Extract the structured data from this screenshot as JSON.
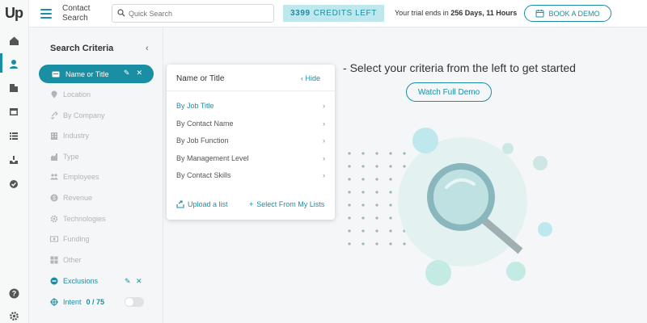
{
  "app": {
    "logo": "Up"
  },
  "header": {
    "page_title": "Contact Search",
    "search_placeholder": "Quick Search",
    "credits_number": "3399",
    "credits_label": "CREDITS LEFT",
    "trial_prefix": "Your trial ends in",
    "trial_value": "256 Days, 11 Hours",
    "book_demo": "BOOK A DEMO"
  },
  "criteria": {
    "title": "Search Criteria",
    "items": [
      {
        "label": "Name or Title",
        "icon": "id-card-icon"
      },
      {
        "label": "Location",
        "icon": "map-pin-icon"
      },
      {
        "label": "By Company",
        "icon": "link-icon"
      },
      {
        "label": "Industry",
        "icon": "building-icon"
      },
      {
        "label": "Type",
        "icon": "factory-icon"
      },
      {
        "label": "Employees",
        "icon": "people-icon"
      },
      {
        "label": "Revenue",
        "icon": "dollar-icon"
      },
      {
        "label": "Technologies",
        "icon": "gear-icon"
      },
      {
        "label": "Funding",
        "icon": "money-icon"
      },
      {
        "label": "Other",
        "icon": "grid-icon"
      },
      {
        "label": "Exclusions",
        "icon": "minus-circle-icon"
      }
    ],
    "intent_label": "Intent",
    "intent_value": "0 / 75"
  },
  "popover": {
    "title": "Name or Title",
    "hide": "Hide",
    "options": [
      "By Job Title",
      "By Contact Name",
      "By Job Function",
      "By Management Level",
      "By Contact Skills"
    ],
    "upload": "Upload a list",
    "select_lists": "Select From My Lists"
  },
  "main": {
    "prompt": "Select your criteria from the left to get started",
    "watch_demo": "Watch Full Demo"
  },
  "colors": {
    "accent": "#1a8ea3",
    "credits_bg": "#bfe8ee"
  }
}
